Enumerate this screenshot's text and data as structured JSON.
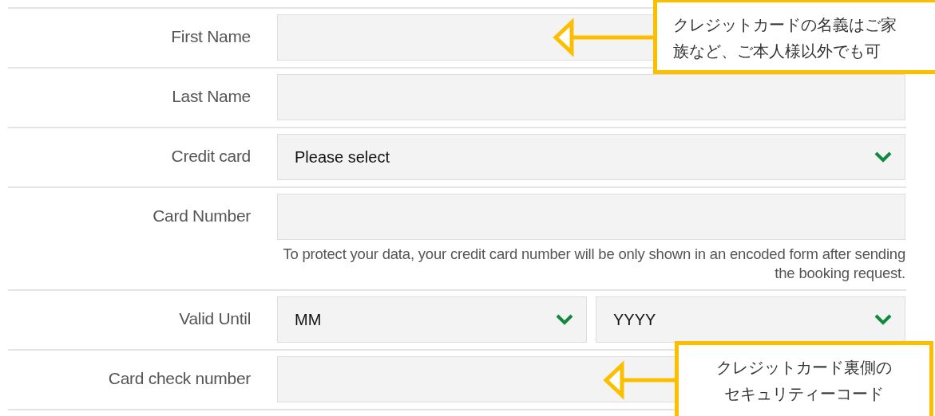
{
  "fields": [
    {
      "label": "First Name",
      "kind": "text"
    },
    {
      "label": "Last Name",
      "kind": "text"
    },
    {
      "label": "Credit card",
      "kind": "select",
      "value": "Please select"
    },
    {
      "label": "Card Number",
      "kind": "text",
      "note": "To protect your data, your credit card number will be only shown in an encoded form after sending the booking request."
    },
    {
      "label": "Valid Until",
      "kind": "select_pair",
      "options": [
        "MM",
        "YYYY"
      ]
    },
    {
      "label": "Card check number",
      "kind": "text"
    }
  ],
  "callouts": [
    {
      "text": "クレジットカードの名義はご家族など、ご本人様以外でも可"
    },
    {
      "text": "クレジットカード裏側のセキュリティーコード"
    }
  ]
}
